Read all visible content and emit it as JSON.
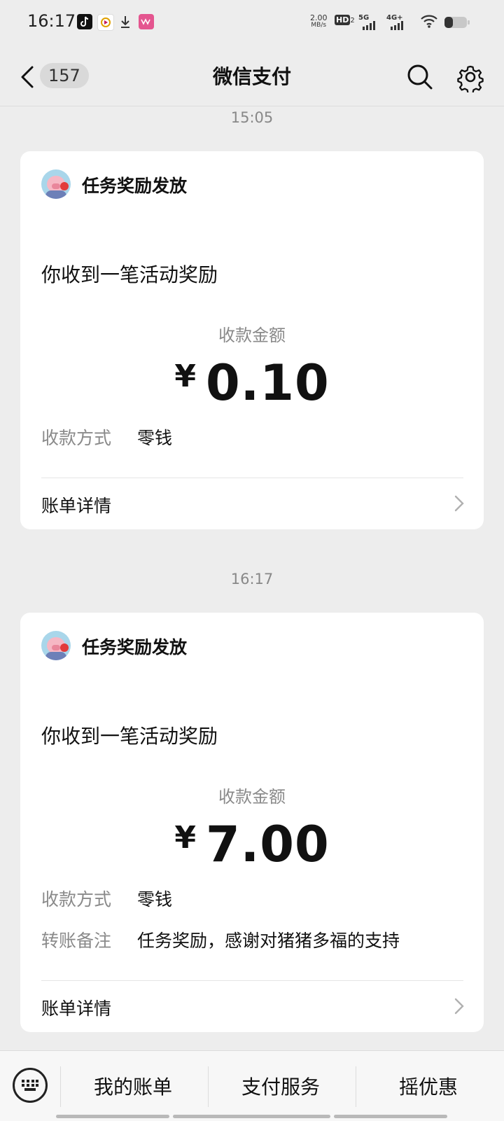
{
  "status_bar": {
    "time": "16:17",
    "net_speed_value": "2.00",
    "net_speed_unit": "MB/s",
    "hd": "HD",
    "sim_slot": "2",
    "sig1": "5G",
    "sig2": "4G+"
  },
  "nav": {
    "unread_count": "157",
    "title": "微信支付"
  },
  "messages": [
    {
      "time": "15:05",
      "sender": "任务奖励发放",
      "headline": "你收到一笔活动奖励",
      "amount_label": "收款金额",
      "currency": "¥",
      "amount": "0.10",
      "method_label": "收款方式",
      "method_value": "零钱",
      "details_label": "账单详情"
    },
    {
      "time": "16:17",
      "sender": "任务奖励发放",
      "headline": "你收到一笔活动奖励",
      "amount_label": "收款金额",
      "currency": "¥",
      "amount": "7.00",
      "method_label": "收款方式",
      "method_value": "零钱",
      "note_label": "转账备注",
      "note_value": "任务奖励，感谢对猪猪多福的支持",
      "details_label": "账单详情"
    }
  ],
  "bottom_menu": {
    "items": [
      "我的账单",
      "支付服务",
      "摇优惠"
    ]
  },
  "colors": {
    "background": "#ededed",
    "card": "#ffffff",
    "muted_text": "#8a8a8a"
  }
}
